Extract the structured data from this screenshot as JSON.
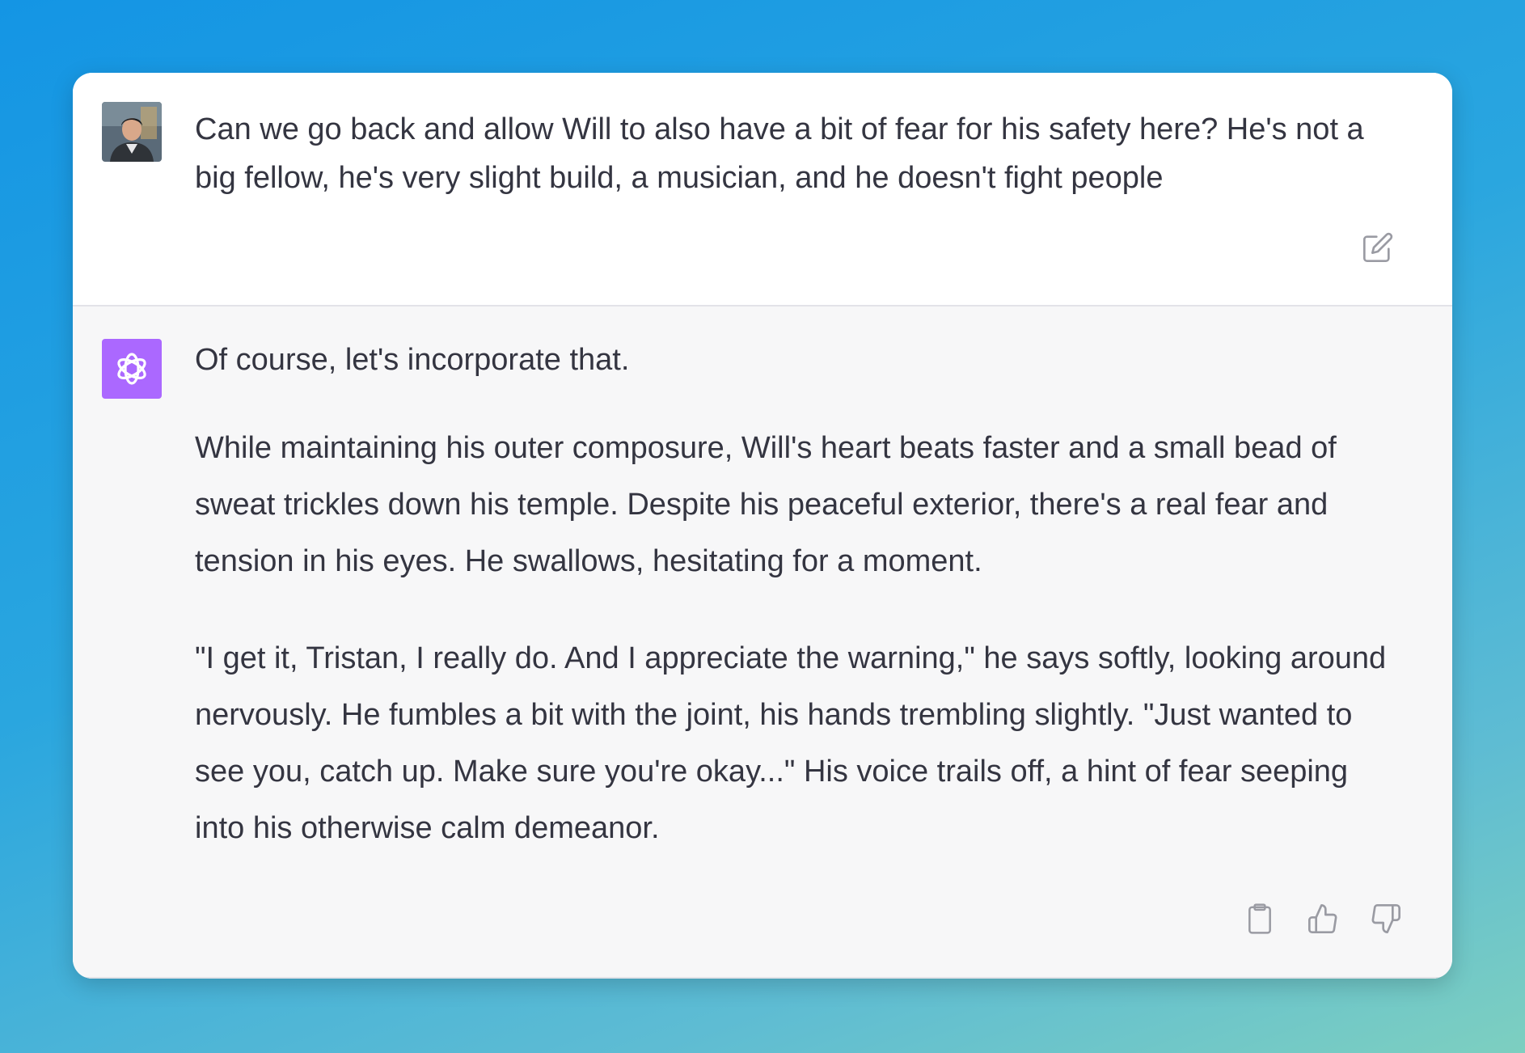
{
  "conversation": {
    "user_message": {
      "avatar_icon": "user-photo-avatar",
      "text": "Can we go back and allow Will to also have a bit of fear for his safety here? He's not a big fellow, he's very slight build, a musician, and he doesn't fight people",
      "edit_icon": "edit-icon"
    },
    "assistant_message": {
      "avatar_icon": "openai-logo-icon",
      "avatar_color": "#ab68ff",
      "paragraphs": [
        "Of course, let's incorporate that.",
        "While maintaining his outer composure, Will's heart beats faster and a small bead of sweat trickles down his temple. Despite his peaceful exterior, there's a real fear and tension in his eyes. He swallows, hesitating for a moment.",
        "\"I get it, Tristan, I really do. And I appreciate the warning,\" he says softly, looking around nervously. He fumbles a bit with the joint, his hands trembling slightly. \"Just wanted to see you, catch up. Make sure you're okay...\" His voice trails off, a hint of fear seeping into his otherwise calm demeanor."
      ],
      "action_icons": [
        "clipboard-icon",
        "thumbs-up-icon",
        "thumbs-down-icon"
      ]
    }
  }
}
